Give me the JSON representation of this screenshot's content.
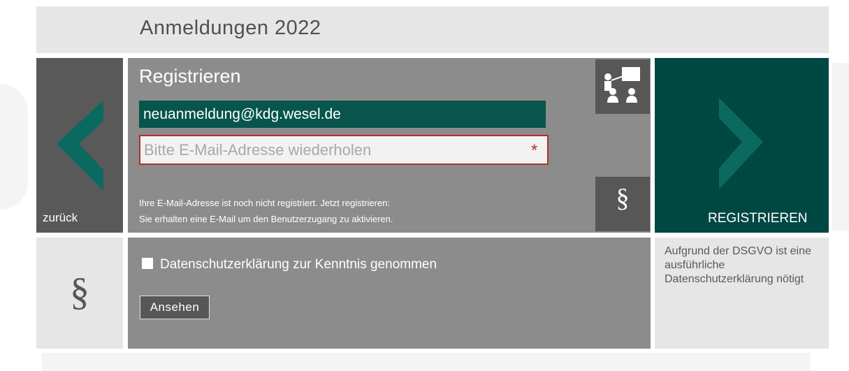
{
  "header": {
    "title": "Anmeldungen 2022"
  },
  "nav": {
    "back_label": "zurück",
    "register_label": "REGISTRIEREN"
  },
  "form": {
    "title": "Registrieren",
    "email_value": "neuanmeldung@kdg.wesel.de",
    "repeat_placeholder": "Bitte E-Mail-Adresse wiederholen",
    "required_marker": "*",
    "info_line1": "Ihre E-Mail-Adresse ist noch nicht registriert. Jetzt registrieren:",
    "info_line2": "Sie erhalten eine E-Mail um den Benutzerzugang zu aktivieren.",
    "paragraph_symbol": "§"
  },
  "privacy": {
    "symbol": "§",
    "checkbox_label": "Datenschutzerklärung zur Kenntnis genommen",
    "view_button": "Ansehen",
    "note": "Aufgrund der DSGVO ist eine ausführliche Datenschutzerklärung nötigt"
  },
  "colors": {
    "accent_dark_teal": "#004843",
    "field_teal": "#07554c",
    "chevron_teal": "#0b6a5f",
    "tile_gray": "#595959",
    "panel_gray": "#8c8c8c",
    "error_red": "#b03030"
  },
  "icons": [
    "chevron-left-icon",
    "chevron-right-icon",
    "teacher-class-icon",
    "paragraph-icon"
  ]
}
